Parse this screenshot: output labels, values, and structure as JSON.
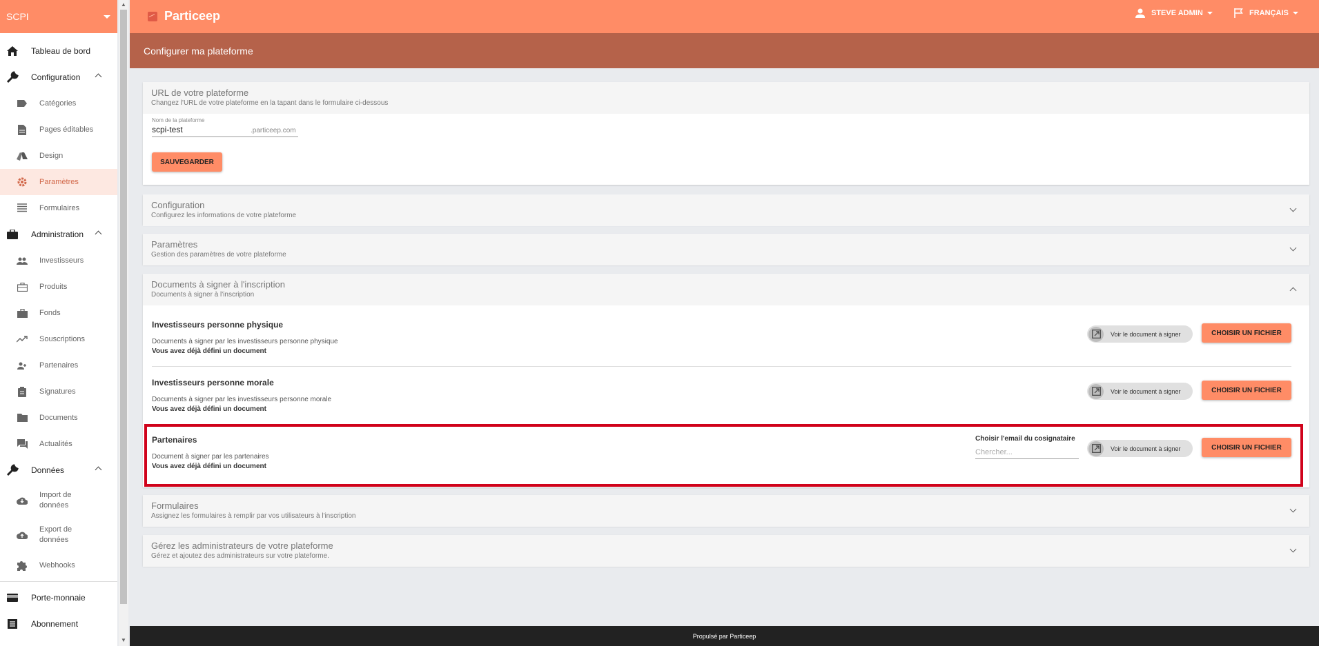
{
  "sidebar": {
    "selector": "SCPI",
    "items": [
      {
        "label": "Tableau de bord"
      },
      {
        "label": "Configuration"
      },
      {
        "label": "Catégories"
      },
      {
        "label": "Pages éditables"
      },
      {
        "label": "Design"
      },
      {
        "label": "Paramètres"
      },
      {
        "label": "Formulaires"
      },
      {
        "label": "Administration"
      },
      {
        "label": "Investisseurs"
      },
      {
        "label": "Produits"
      },
      {
        "label": "Fonds"
      },
      {
        "label": "Souscriptions"
      },
      {
        "label": "Partenaires"
      },
      {
        "label": "Signatures"
      },
      {
        "label": "Documents"
      },
      {
        "label": "Actualités"
      },
      {
        "label": "Données"
      },
      {
        "label": "Import de données"
      },
      {
        "label": "Export de données"
      },
      {
        "label": "Webhooks"
      },
      {
        "label": "Porte-monnaie"
      },
      {
        "label": "Abonnement"
      }
    ]
  },
  "header": {
    "brand": "Particeep",
    "user": "STEVE ADMIN",
    "language": "FRANÇAIS",
    "page_title": "Configurer ma plateforme"
  },
  "url_panel": {
    "title": "URL de votre plateforme",
    "subtitle": "Changez l'URL de votre plateforme en la tapant dans le formulaire ci-dessous",
    "field_label": "Nom de la plateforme",
    "field_value": "scpi-test",
    "suffix": ".particeep.com",
    "save_label": "SAUVEGARDER"
  },
  "panels": [
    {
      "title": "Configuration",
      "subtitle": "Configurez les informations de votre plateforme"
    },
    {
      "title": "Paramètres",
      "subtitle": "Gestion des paramètres de votre plateforme"
    },
    {
      "title": "Documents à signer à l'inscription",
      "subtitle": "Documents à signer à l'inscription"
    },
    {
      "title": "Formulaires",
      "subtitle": "Assignez les formulaires à remplir par vos utilisateurs à l'inscription"
    },
    {
      "title": "Gérez les administrateurs de votre plateforme",
      "subtitle": "Gérez et ajoutez des administrateurs sur votre plateforme."
    }
  ],
  "documents": [
    {
      "title": "Investisseurs personne physique",
      "desc": "Documents à signer par les investisseurs personne physique",
      "status": "Vous avez déjà défini un document"
    },
    {
      "title": "Investisseurs personne morale",
      "desc": "Documents à signer par les investisseurs personne morale",
      "status": "Vous avez déjà défini un document"
    },
    {
      "title": "Partenaires",
      "desc": "Document à signer par les partenaires",
      "status": "Vous avez déjà défini un document"
    }
  ],
  "actions": {
    "view_doc": "Voir le document à signer",
    "choose_file": "CHOISIR UN FICHIER",
    "cosign_label": "Choisir l'email du cosignataire",
    "cosign_placeholder": "Chercher..."
  },
  "footer": "Propulsé par Particeep",
  "colors": {
    "primary": "#ff8c66",
    "dark_primary": "#b5624a",
    "highlight": "#d0021b"
  }
}
